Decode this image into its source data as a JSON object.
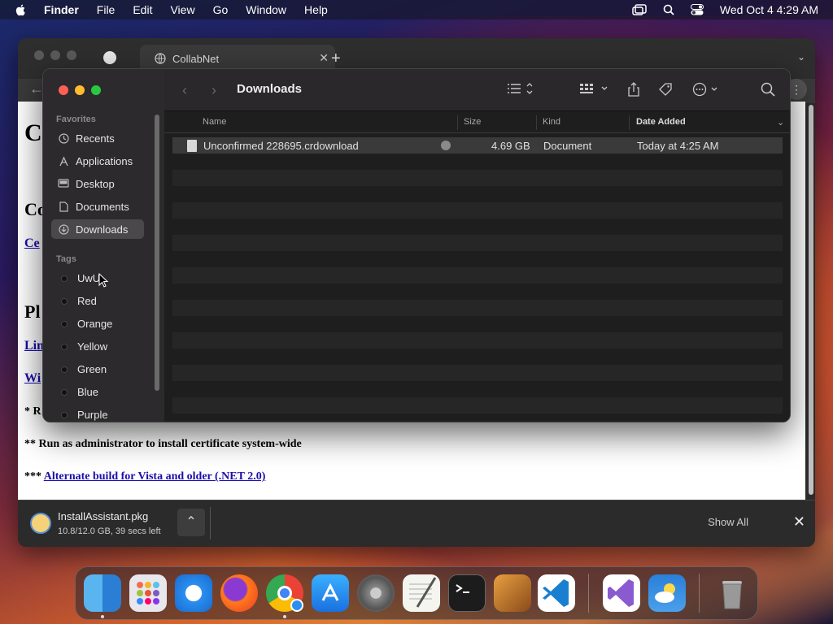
{
  "menubar": {
    "app_name": "Finder",
    "items": [
      "File",
      "Edit",
      "View",
      "Go",
      "Window",
      "Help"
    ],
    "clock": "Wed Oct 4  4:29 AM"
  },
  "browser": {
    "tab_title": "CollabNet",
    "page": {
      "fragments": {
        "h1": "C",
        "h2": "Co",
        "link1": "Ce",
        "h3": "Pl",
        "link2": "Lin",
        "link3": "Wi",
        "note1": "* R"
      },
      "admin_note": "** Run as administrator to install certificate system-wide",
      "alt_prefix": "***",
      "alt_link": "Alternate build for Vista and older (.NET 2.0)"
    },
    "download": {
      "filename": "InstallAssistant.pkg",
      "status": "10.8/12.0 GB, 39 secs left",
      "show_all": "Show All"
    }
  },
  "finder": {
    "title": "Downloads",
    "sidebar": {
      "favorites_label": "Favorites",
      "favorites": [
        "Recents",
        "Applications",
        "Desktop",
        "Documents",
        "Downloads"
      ],
      "tags_label": "Tags",
      "tags": [
        "UwU",
        "Red",
        "Orange",
        "Yellow",
        "Green",
        "Blue",
        "Purple"
      ]
    },
    "columns": {
      "name": "Name",
      "size": "Size",
      "kind": "Kind",
      "date": "Date Added"
    },
    "files": [
      {
        "name": "Unconfirmed 228695.crdownload",
        "size": "4.69 GB",
        "kind": "Document",
        "date": "Today at 4:25 AM"
      }
    ]
  },
  "dock": {
    "apps": [
      "Finder",
      "Launchpad",
      "Safari",
      "Firefox",
      "Chrome",
      "App Store",
      "System Settings",
      "TextEdit",
      "Terminal",
      "GarageBand",
      "Visual Studio Code",
      "Visual Studio",
      "Weather",
      "Trash"
    ]
  },
  "colors": {
    "accent_link": "#1a0dab",
    "traffic_red": "#ff5f57",
    "traffic_yellow": "#febc2e",
    "traffic_green": "#28c840"
  }
}
